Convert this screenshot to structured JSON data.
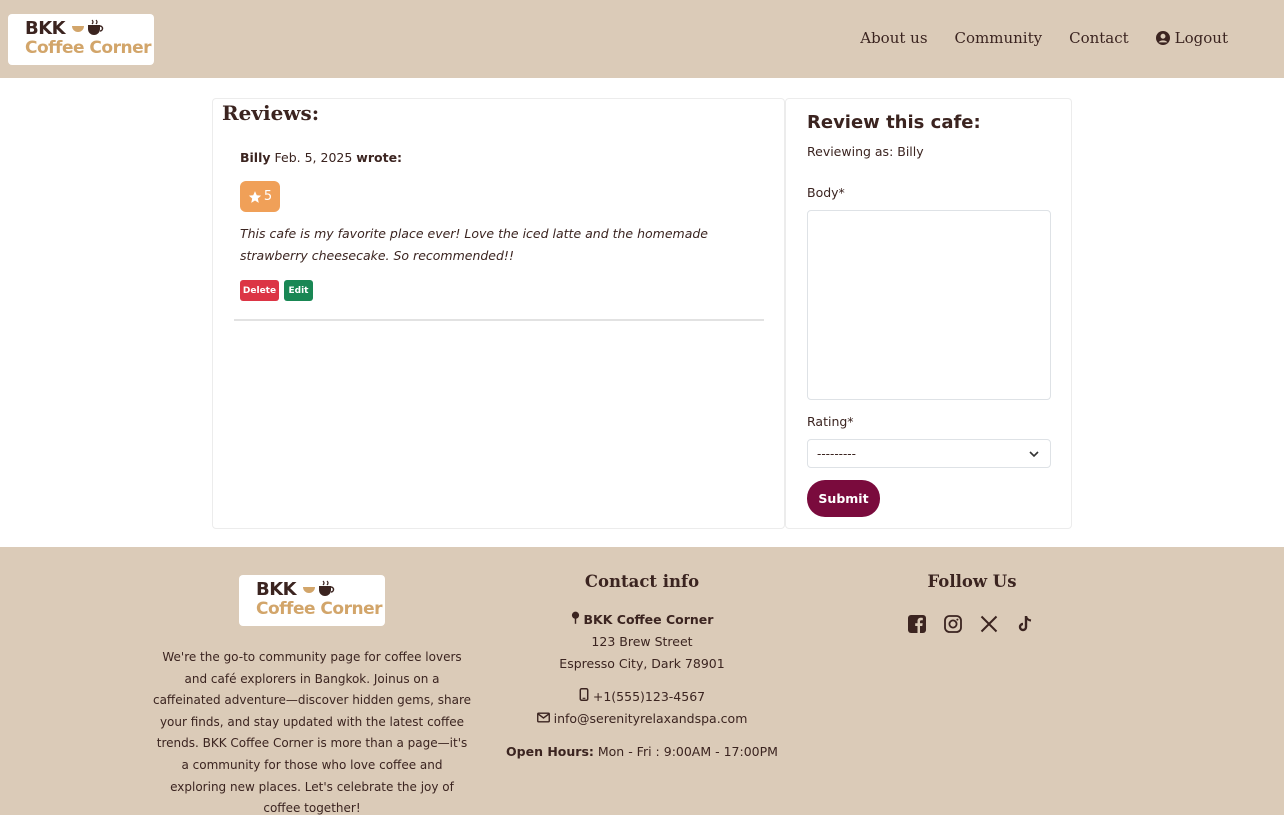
{
  "brand": {
    "line1": "BKK",
    "line2": "Coffee Corner"
  },
  "nav": {
    "about": "About us",
    "community": "Community",
    "contact": "Contact",
    "logout": "Logout"
  },
  "reviews": {
    "title": "Reviews:",
    "items": [
      {
        "author": "Billy",
        "date": "Feb. 5, 2025",
        "wrote": "wrote:",
        "rating": "5",
        "body": "This cafe is my favorite place ever! Love the iced latte and the homemade strawberry cheesecake. So recommended!!",
        "delete_label": "Delete",
        "edit_label": "Edit"
      }
    ]
  },
  "form": {
    "title": "Review this cafe:",
    "reviewing_as": "Reviewing as: Billy",
    "body_label": "Body*",
    "body_value": "",
    "rating_label": "Rating*",
    "rating_value": "---------",
    "submit_label": "Submit"
  },
  "footer": {
    "about": "We're the go-to community page for coffee lovers and café explorers in Bangkok. Joinus on a caffeinated adventure—discover hidden gems, share your finds, and stay updated with the latest coffee trends. BKK Coffee Corner is more than a page—it's a community for those who love coffee and exploring new places. Let's celebrate the joy of coffee together!",
    "contact_title": "Contact info",
    "contact_name": "BKK Coffee Corner",
    "address1": "123 Brew Street",
    "address2": "Espresso City, Dark 78901",
    "phone": "+1(555)123-4567",
    "email": "info@serenityrelaxandspa.com",
    "hours_label": "Open Hours:",
    "hours_value": "Mon - Fri : 9:00AM - 17:00PM",
    "follow_title": "Follow Us",
    "social_icons": [
      "facebook-icon",
      "instagram-icon",
      "x-icon",
      "tiktok-icon"
    ]
  },
  "colors": {
    "nav_bg": "#dbcbb8",
    "text": "#3b2420",
    "accent_gold": "#d2a56a",
    "rating_badge": "#f0a058",
    "delete": "#dc3545",
    "edit": "#198754",
    "submit": "#7a0b3d"
  }
}
